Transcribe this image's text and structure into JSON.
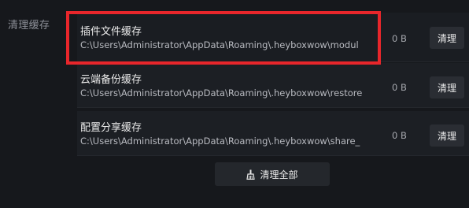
{
  "section": {
    "label": "清理缓存"
  },
  "cache_items": [
    {
      "title": "插件文件缓存",
      "path": "C:\\Users\\Administrator\\AppData\\Roaming\\.heyboxwow\\modul",
      "size": "0 B",
      "button_label": "清理"
    },
    {
      "title": "云端备份缓存",
      "path": "C:\\Users\\Administrator\\AppData\\Roaming\\.heyboxwow\\restore",
      "size": "0 B",
      "button_label": "清理"
    },
    {
      "title": "配置分享缓存",
      "path": "C:\\Users\\Administrator\\AppData\\Roaming\\.heyboxwow\\share_",
      "size": "0 B",
      "button_label": "清理"
    }
  ],
  "clear_all": {
    "label": "清理全部",
    "icon": "broom-icon"
  },
  "colors": {
    "background": "#16181c",
    "row_background": "#1c1f24",
    "button_background": "#2a2d33",
    "highlight_border": "#e8262b"
  }
}
